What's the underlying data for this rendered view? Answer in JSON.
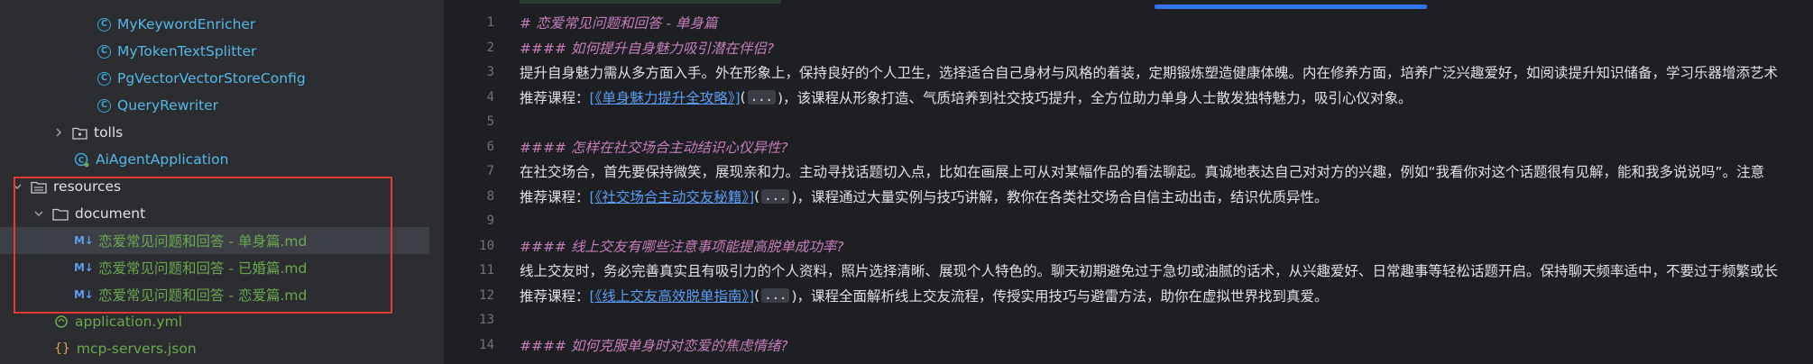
{
  "tree": {
    "items": [
      {
        "label": "MyKeywordEnricher",
        "kind": "class"
      },
      {
        "label": "MyTokenTextSplitter",
        "kind": "class"
      },
      {
        "label": "PgVectorVectorStoreConfig",
        "kind": "class"
      },
      {
        "label": "QueryRewriter",
        "kind": "class"
      },
      {
        "label": "tolls",
        "kind": "package"
      },
      {
        "label": "AiAgentApplication",
        "kind": "app"
      },
      {
        "label": "resources",
        "kind": "resource-folder"
      },
      {
        "label": "document",
        "kind": "folder"
      },
      {
        "label": "恋爱常见问题和回答 - 单身篇.md",
        "kind": "markdown",
        "icon": "M↓"
      },
      {
        "label": "恋爱常见问题和回答 - 已婚篇.md",
        "kind": "markdown",
        "icon": "M↓"
      },
      {
        "label": "恋爱常见问题和回答 - 恋爱篇.md",
        "kind": "markdown",
        "icon": "M↓"
      },
      {
        "label": "application.yml",
        "kind": "yaml"
      },
      {
        "label": "mcp-servers.json",
        "kind": "json",
        "icon": "{}"
      }
    ],
    "selected_item": "恋爱常见问题和回答 - 单身篇.md"
  },
  "editor": {
    "line_numbers": [
      "1",
      "2",
      "3",
      "4",
      "5",
      "6",
      "7",
      "8",
      "9",
      "10",
      "11",
      "12",
      "13",
      "14"
    ],
    "lines": {
      "l1": "# 恋爱常见问题和回答 - 单身篇",
      "l2": "#### 如何提升自身魅力吸引潜在伴侣?",
      "l3": "提升自身魅力需从多方面入手。外在形象上，保持良好的个人卫生，选择适合自己身材与风格的着装，定期锻炼塑造健康体魄。内在修养方面，培养广泛兴趣爱好，如阅读提升知识储备，学习乐器增添艺术",
      "l4_prefix": "推荐课程：",
      "l4_link": "[《单身魅力提升全攻略》]",
      "l4_open": "(",
      "l4_dots": "...",
      "l4_rest": ")，该课程从形象打造、气质培养到社交技巧提升，全方位助力单身人士散发独特魅力，吸引心仪对象。",
      "l6": "#### 怎样在社交场合主动结识心仪异性?",
      "l7": "在社交场合，首先要保持微笑，展现亲和力。主动寻找话题切入点，比如在画展上可从对某幅作品的看法聊起。真诚地表达自己对对方的兴趣，例如“我看你对这个话题很有见解，能和我多说说吗”。注意",
      "l8_prefix": "推荐课程：",
      "l8_link": "[《社交场合主动交友秘籍》]",
      "l8_open": "(",
      "l8_dots": "...",
      "l8_rest": ")，课程通过大量实例与技巧讲解，教你在各类社交场合自信主动出击，结识优质异性。",
      "l10": "#### 线上交友有哪些注意事项能提高脱单成功率?",
      "l11": "线上交友时，务必完善真实且有吸引力的个人资料，照片选择清晰、展现个人特色的。聊天初期避免过于急切或油腻的话术，从兴趣爱好、日常趣事等轻松话题开启。保持聊天频率适中，不要过于频繁或长",
      "l12_prefix": "推荐课程：",
      "l12_link": "[《线上交友高效脱单指南》]",
      "l12_open": "(",
      "l12_dots": "...",
      "l12_rest": ")，课程全面解析线上交友流程，传授实用技巧与避雷方法，助你在虚拟世界找到真爱。",
      "l14": "#### 如何克服单身时对恋爱的焦虑情绪?"
    }
  },
  "colors": {
    "tree_bg": "#2b2d30",
    "editor_bg": "#1e1f22",
    "heading": "#c77dbb",
    "link": "#5a9ef5",
    "markdown_file": "#6ba84f",
    "class_label": "#55b7e8",
    "highlight_box": "#e53935"
  }
}
